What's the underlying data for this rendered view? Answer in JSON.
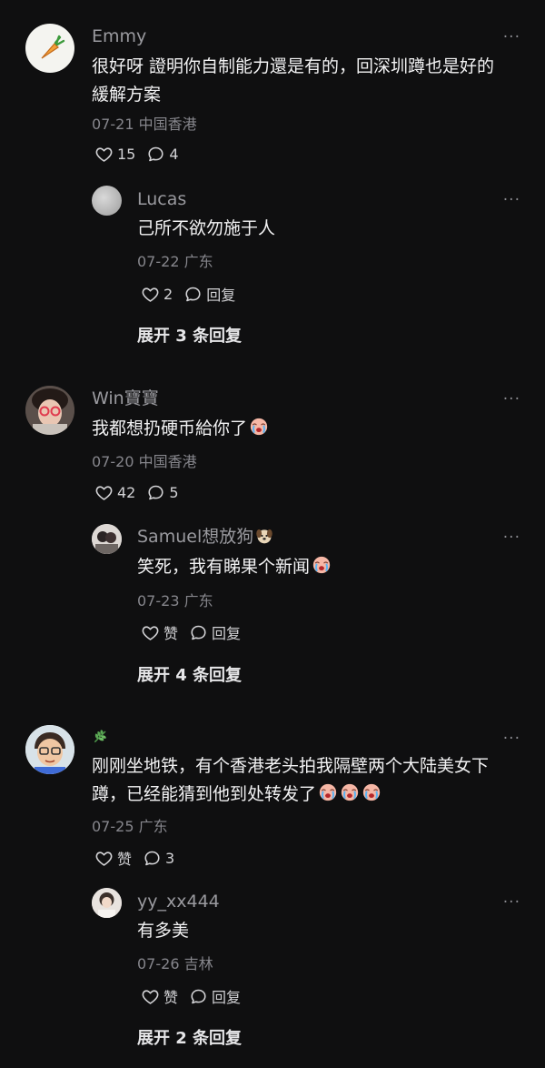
{
  "comments": [
    {
      "name": "Emmy",
      "text_line1": "很好呀 證明你自制能力還是有的，回深圳蹲也是好的",
      "text_line2": "緩解方案",
      "meta": "07-21 中国香港",
      "likes": "15",
      "comments": "4",
      "avatar_icon": "carrot-icon",
      "reply": {
        "name": "Lucas",
        "text": "己所不欲勿施于人",
        "meta": "07-22 广东",
        "likes": "2",
        "reply_label": "回复"
      },
      "expand_label": "展开 3 条回复"
    },
    {
      "name": "Win寶寶",
      "text": "我都想扔硬币給你了",
      "meta": "07-20 中国香港",
      "likes": "42",
      "comments": "5",
      "reply": {
        "name": "Samuel想放狗",
        "text": "笑死，我有睇果个新闻",
        "meta": "07-23 广东",
        "likes": "赞",
        "reply_label": "回复"
      },
      "expand_label": "展开 4 条回复"
    },
    {
      "name_icon": "leaf-icon",
      "text_line1": "刚刚坐地铁，有个香港老头拍我隔壁两个大陆美女下",
      "text_line2": "蹲，已经能猜到他到处转发了",
      "meta": "07-25 广东",
      "likes": "赞",
      "comments": "3",
      "reply": {
        "name": "yy_xx444",
        "text": "有多美",
        "meta": "07-26 吉林",
        "likes": "赞",
        "reply_label": "回复"
      },
      "expand_label": "展开 2 条回复"
    }
  ],
  "more_label": "···"
}
